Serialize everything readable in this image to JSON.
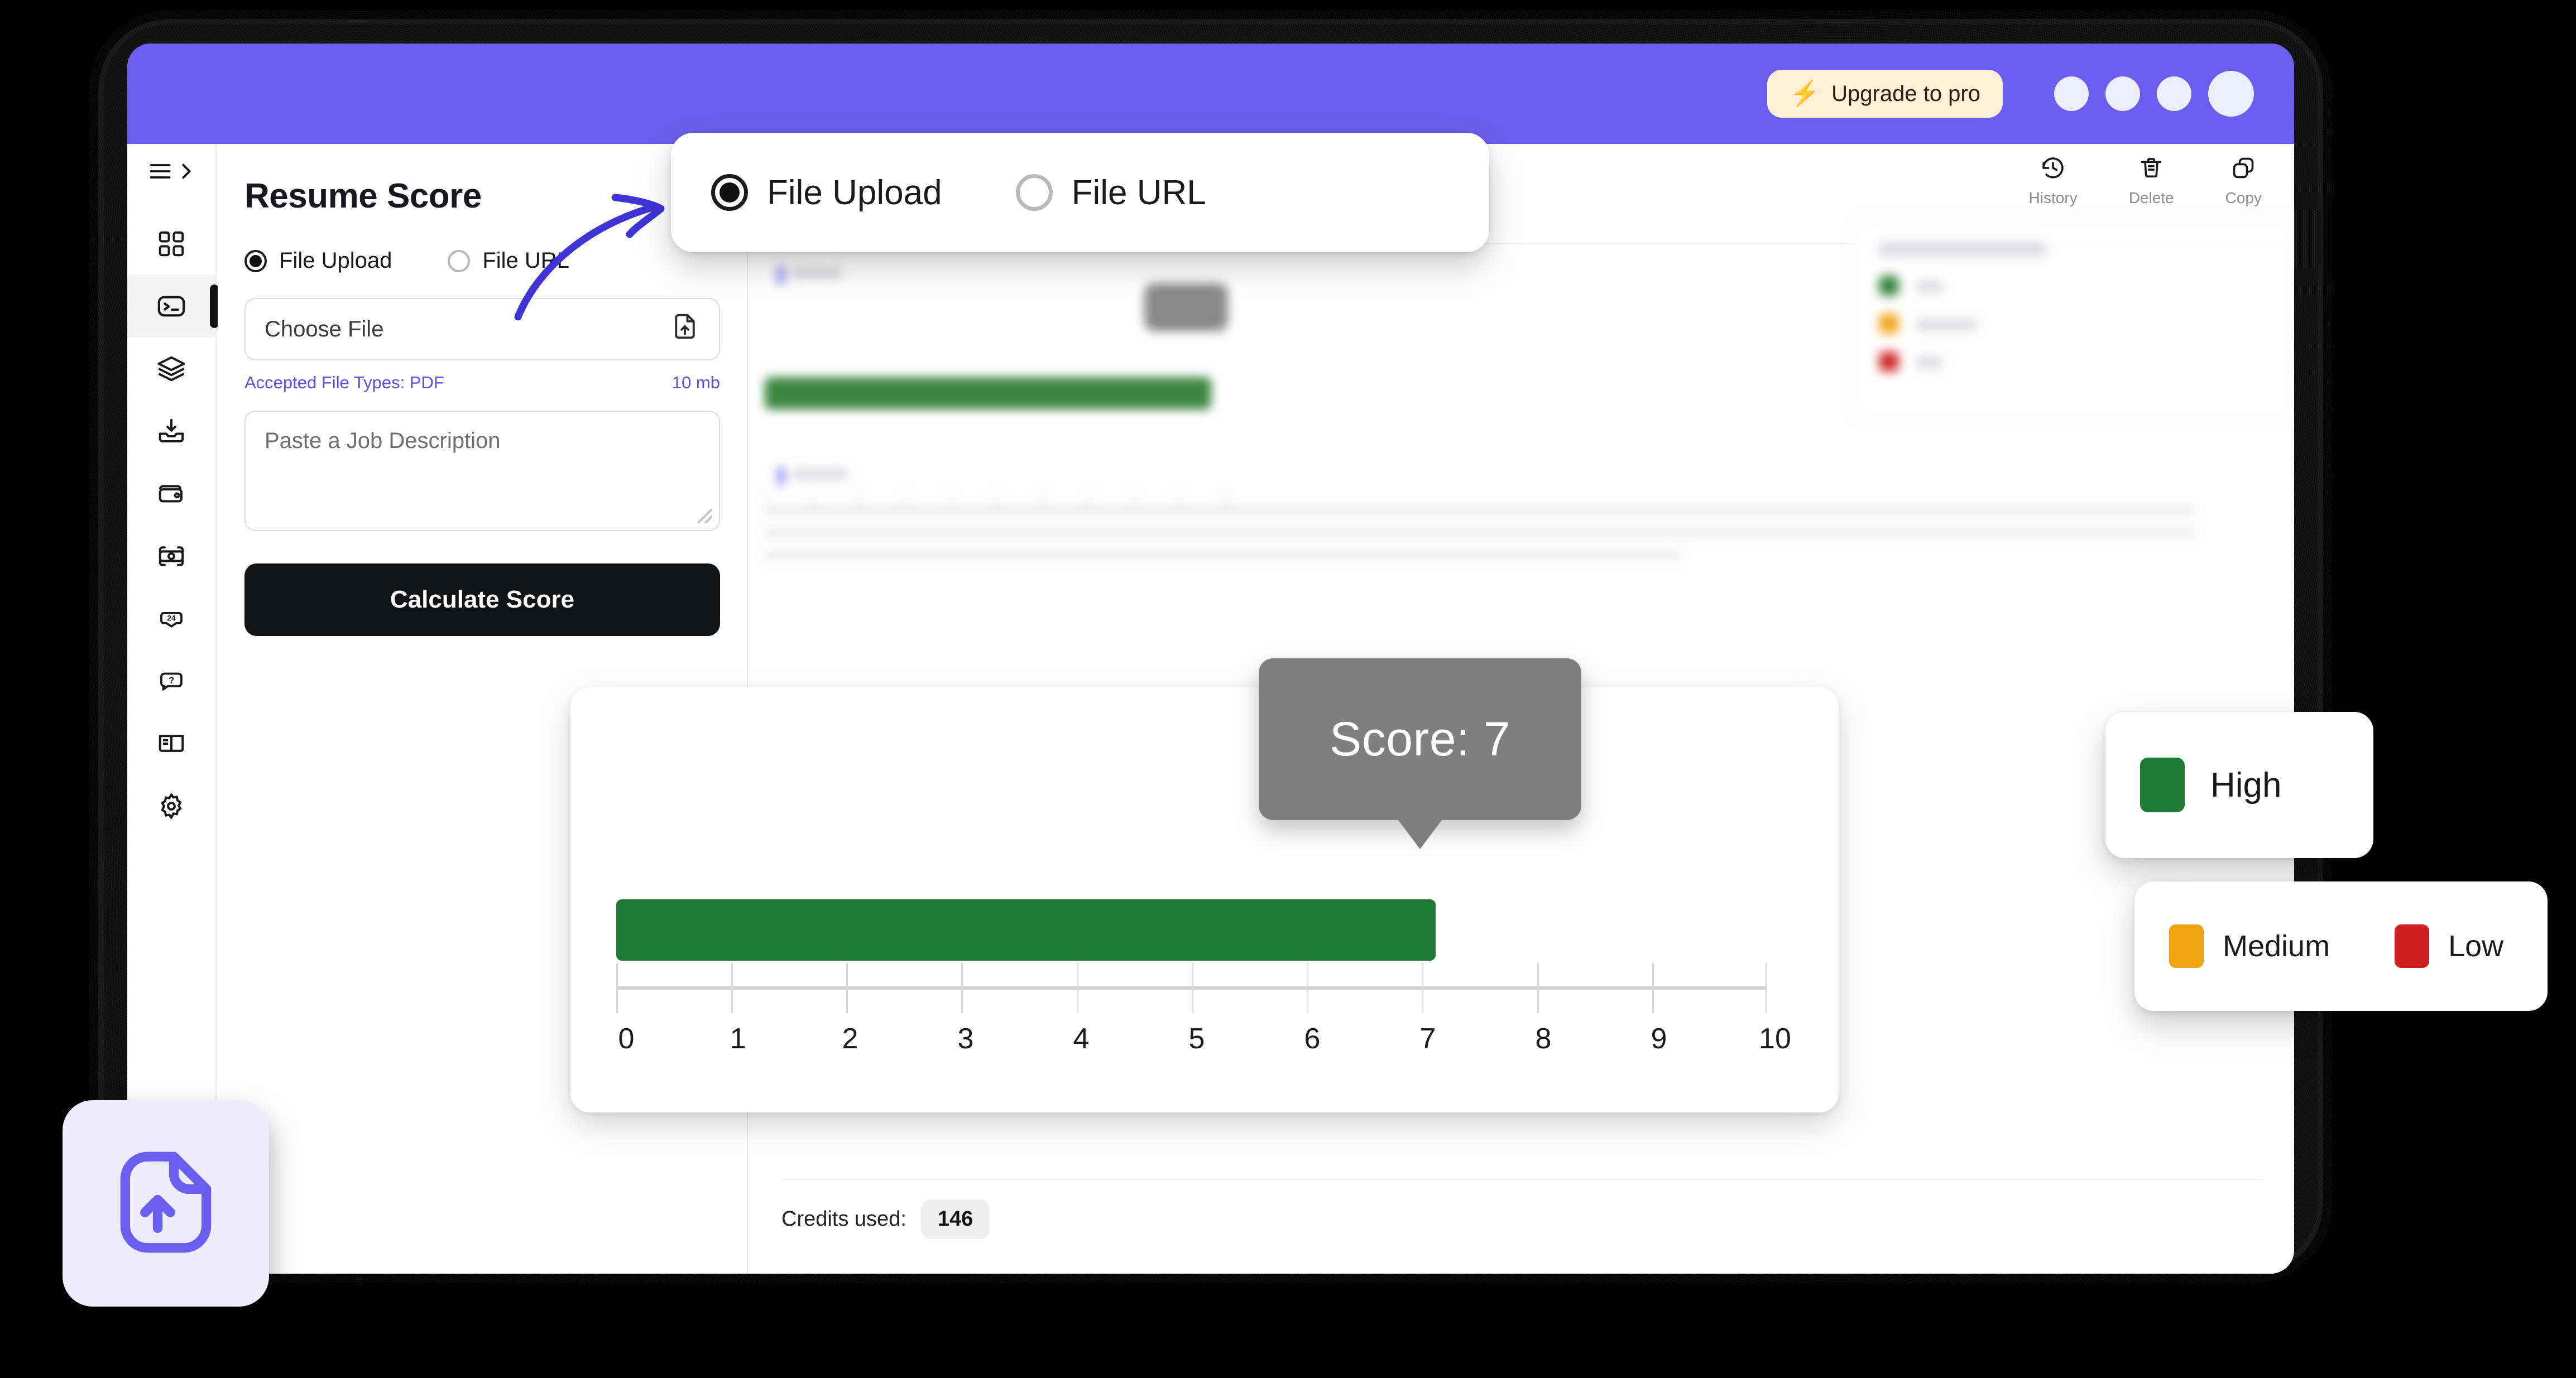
{
  "topbar": {
    "upgrade_label": "Upgrade to pro",
    "bolt_icon": "lightning-bolt-icon",
    "accent_color": "#6a5ef0",
    "upgrade_bg": "#fdeed8"
  },
  "rail": {
    "menu_icon": "hamburger-menu-icon",
    "expand_icon": "chevron-right-icon",
    "items": [
      {
        "icon": "grid-dashboard-icon",
        "name": "dashboard"
      },
      {
        "icon": "terminal-icon",
        "name": "tools",
        "active": true
      },
      {
        "icon": "layers-icon",
        "name": "layers"
      },
      {
        "icon": "inbox-download-icon",
        "name": "inbox"
      },
      {
        "icon": "wallet-icon",
        "name": "wallet"
      },
      {
        "icon": "camera-scan-icon",
        "name": "scan"
      },
      {
        "icon": "support-24-icon",
        "name": "support"
      },
      {
        "icon": "help-bubble-icon",
        "name": "help"
      },
      {
        "icon": "book-icon",
        "name": "docs"
      },
      {
        "icon": "gear-icon",
        "name": "settings"
      }
    ]
  },
  "panel": {
    "title": "Resume Score",
    "radio_options": [
      {
        "label": "File Upload",
        "selected": true
      },
      {
        "label": "File URL",
        "selected": false
      }
    ],
    "file_field_label": "Choose File",
    "file_upload_icon": "file-upload-icon",
    "accepted_types": "Accepted File Types: PDF",
    "max_size": "10 mb",
    "job_description_placeholder": "Paste a Job Description",
    "submit_label": "Calculate Score",
    "hint_color": "#5b4ee8"
  },
  "toolbar": {
    "items": [
      {
        "label": "History",
        "icon": "history-clock-icon"
      },
      {
        "label": "Delete",
        "icon": "trash-icon"
      },
      {
        "label": "Copy",
        "icon": "copy-icon"
      }
    ]
  },
  "footer": {
    "credits_label": "Credits used:",
    "credits_value": "146"
  },
  "popup": {
    "options": [
      {
        "label": "File Upload",
        "selected": true
      },
      {
        "label": "File URL",
        "selected": false
      }
    ],
    "arrow_icon": "curved-arrow-icon",
    "arrow_color": "#3f34d6"
  },
  "legend": {
    "high": {
      "label": "High",
      "color": "#1f7a33"
    },
    "medium": {
      "label": "Medium",
      "color": "#efa411"
    },
    "low": {
      "label": "Low",
      "color": "#cf2020"
    }
  },
  "upload_badge": {
    "icon": "file-upload-icon",
    "bg": "#eeecfc",
    "stroke": "#6a5ef0"
  },
  "chart_data": {
    "type": "bar",
    "title": "Resume Score",
    "orientation": "horizontal",
    "categories": [
      "Score"
    ],
    "values": [
      7
    ],
    "value_label": "Score: 7",
    "xlabel": "",
    "ylabel": "",
    "xlim": [
      0,
      10
    ],
    "xticks": [
      0,
      1,
      2,
      3,
      4,
      5,
      6,
      7,
      8,
      9,
      10
    ],
    "xtick_labels": [
      "0",
      "1",
      "2",
      "3",
      "4",
      "5",
      "6",
      "7",
      "8",
      "9",
      "10"
    ],
    "grid": false,
    "bar_color": "#1f7a33",
    "tooltip_bg": "#7f7f7f",
    "legend_position": "right",
    "legend": [
      {
        "name": "High",
        "color": "#1f7a33"
      },
      {
        "name": "Medium",
        "color": "#efa411"
      },
      {
        "name": "Low",
        "color": "#cf2020"
      }
    ]
  }
}
